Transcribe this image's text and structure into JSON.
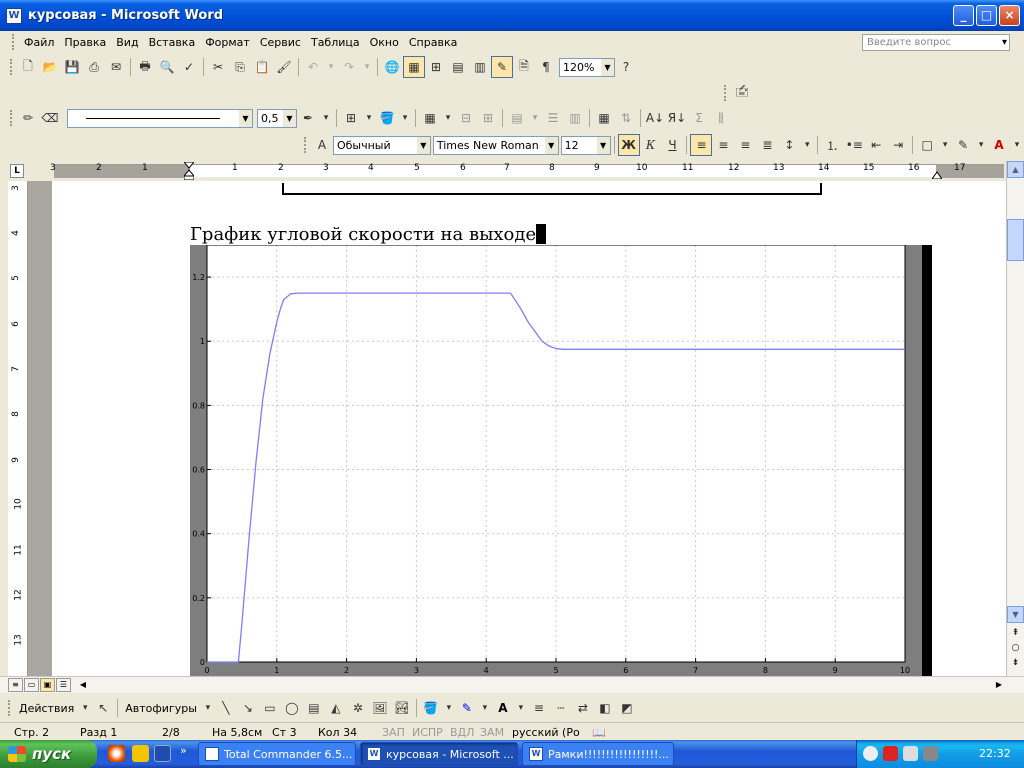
{
  "window": {
    "title": "курсовая - Microsoft Word",
    "app_icon_letter": "W",
    "min_label": "_",
    "max_label": "□",
    "close_label": "×"
  },
  "menu": {
    "items": [
      "Файл",
      "Правка",
      "Вид",
      "Вставка",
      "Формат",
      "Сервис",
      "Таблица",
      "Окно",
      "Справка"
    ],
    "ask_placeholder": "Введите вопрос"
  },
  "toolbar_standard": {
    "zoom": "120%"
  },
  "toolbar_drawing_lines": {
    "line_width": "0,5"
  },
  "toolbar_formatting": {
    "style": "Обычный",
    "font": "Times New Roman",
    "size": "12",
    "bold_label": "Ж",
    "italic_label": "К",
    "underline_label": "Ч"
  },
  "ruler": {
    "tab_symbol": "L",
    "left_numbers": [
      "3",
      "2",
      "1"
    ],
    "right_numbers": [
      "1",
      "2",
      "3",
      "4",
      "5",
      "6",
      "7",
      "8",
      "9",
      "10",
      "11",
      "12",
      "13",
      "14",
      "15",
      "16",
      "17"
    ],
    "vertical_numbers": [
      "3",
      "4",
      "5",
      "6",
      "7",
      "8",
      "9",
      "10",
      "11",
      "12",
      "13"
    ]
  },
  "document": {
    "heading": "График угловой скорости на выходе"
  },
  "chart_data": {
    "type": "line",
    "title": "",
    "xlabel": "",
    "ylabel": "",
    "xlim": [
      0,
      10
    ],
    "ylim": [
      0,
      1.3
    ],
    "xticks": [
      "0",
      "1",
      "2",
      "3",
      "4",
      "5",
      "6",
      "7",
      "8",
      "9",
      "10"
    ],
    "yticks": [
      "0",
      "0.2",
      "0.4",
      "0.6",
      "0.8",
      "1",
      "1.2"
    ],
    "grid": true,
    "line_color": "#7d7dff",
    "series": [
      {
        "x": [
          0,
          0.45,
          0.5,
          0.6,
          0.7,
          0.8,
          0.9,
          1.0,
          1.05,
          1.1,
          1.2,
          1.3,
          2.0,
          3.0,
          4.0,
          4.35,
          4.5,
          4.6,
          4.7,
          4.8,
          4.9,
          5.0,
          5.1,
          5.2,
          6.0,
          7.0,
          8.0,
          9.0,
          10.0
        ],
        "y": [
          0,
          0,
          0.12,
          0.38,
          0.62,
          0.82,
          0.96,
          1.06,
          1.1,
          1.13,
          1.148,
          1.15,
          1.15,
          1.15,
          1.15,
          1.15,
          1.1,
          1.06,
          1.03,
          1.0,
          0.985,
          0.977,
          0.975,
          0.975,
          0.975,
          0.975,
          0.975,
          0.975,
          0.975
        ]
      }
    ]
  },
  "drawing_bar": {
    "actions": "Действия",
    "autoshapes": "Автофигуры"
  },
  "status": {
    "page": "Стр. 2",
    "section": "Разд 1",
    "pages": "2/8",
    "at": "На 5,8см",
    "line": "Ст 3",
    "col": "Кол 34",
    "rec": "ЗАП",
    "trk": "ИСПР",
    "ext": "ВДЛ",
    "ovr": "ЗАМ",
    "lang": "русский (Ро"
  },
  "taskbar": {
    "start": "пуск",
    "more": "»",
    "tasks": [
      "Total Commander 6.5...",
      "курсовая - Microsoft ...",
      "Рамки!!!!!!!!!!!!!!!!!..."
    ],
    "lang": "RU",
    "clock": "22:32"
  }
}
